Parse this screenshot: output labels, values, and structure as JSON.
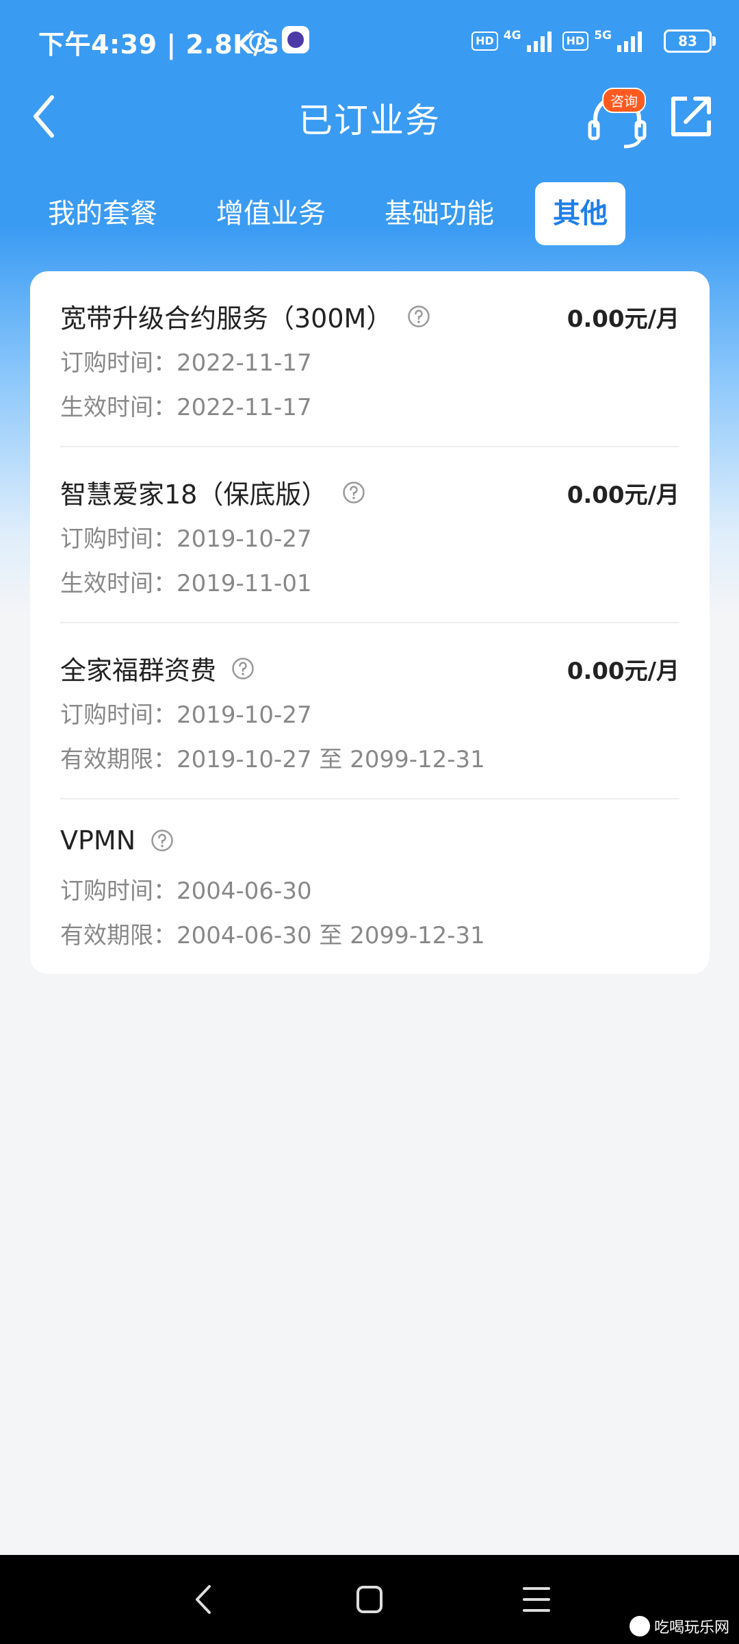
{
  "status_bar": {
    "time": "下午4:39 | 2.8K/s",
    "hd1": "HD",
    "net1": "4G",
    "hd2": "HD",
    "net2": "5G",
    "battery": "83"
  },
  "header": {
    "title": "已订业务",
    "consult_badge": "咨询"
  },
  "tabs": [
    {
      "label": "我的套餐"
    },
    {
      "label": "增值业务"
    },
    {
      "label": "基础功能"
    },
    {
      "label": "其他",
      "active": true
    }
  ],
  "items": [
    {
      "name": "宽带升级合约服务（300M）",
      "price": "0.00元/月",
      "line1": "订购时间：2022-11-17",
      "line2": "生效时间：2022-11-17"
    },
    {
      "name": "智慧爱家18（保底版）",
      "price": "0.00元/月",
      "line1": "订购时间：2019-10-27",
      "line2": "生效时间：2019-11-01"
    },
    {
      "name": "全家福群资费",
      "price": "0.00元/月",
      "line1": "订购时间：2019-10-27",
      "line2": "有效期限：2019-10-27 至 2099-12-31"
    },
    {
      "name": "VPMN",
      "price": "",
      "line1": "订购时间：2004-06-30",
      "line2": "有效期限：2004-06-30 至 2099-12-31"
    }
  ],
  "watermark": "吃喝玩乐网",
  "colors": {
    "primary": "#3a9bf3",
    "tab_active_text": "#1f7fea",
    "badge": "#ff5a1f"
  }
}
